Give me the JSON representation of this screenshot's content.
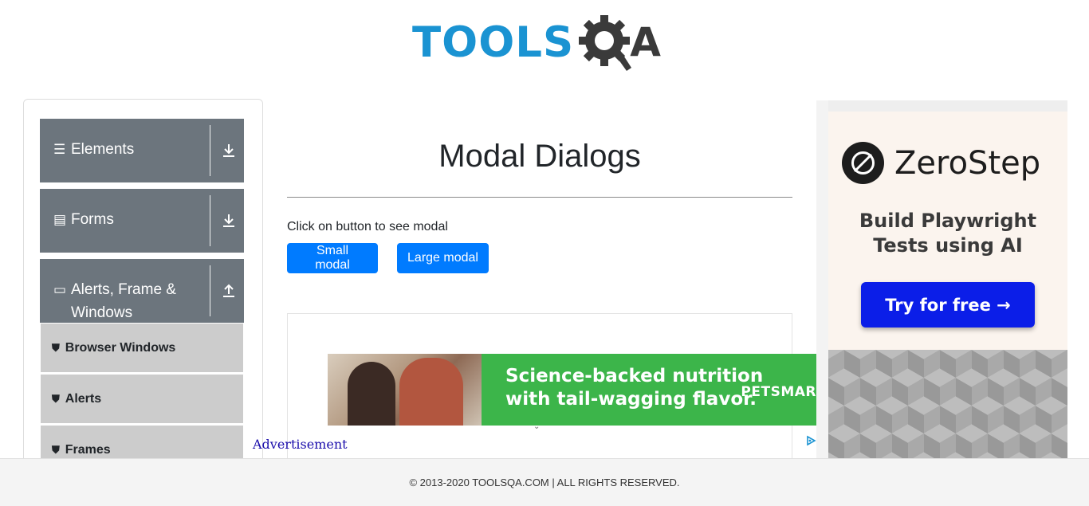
{
  "header": {
    "logo_text_main": "TOOLS",
    "logo_text_suffix": "A"
  },
  "sidebar": {
    "groups": [
      {
        "label": "Elements",
        "icon": "hamburger-icon",
        "arrow": "download-arrow-icon"
      },
      {
        "label": "Forms",
        "icon": "document-icon",
        "arrow": "download-arrow-icon"
      },
      {
        "label": "Alerts, Frame &",
        "label2": "Windows",
        "icon": "window-icon",
        "arrow": "upload-arrow-icon"
      }
    ],
    "sub_items": [
      {
        "label": "Browser Windows",
        "icon": "html5-icon"
      },
      {
        "label": "Alerts",
        "icon": "html5-icon"
      },
      {
        "label": "Frames",
        "icon": "html5-icon"
      }
    ]
  },
  "main": {
    "title": "Modal Dialogs",
    "hint": "Click on button to see modal",
    "small_button": "Small modal",
    "large_button": "Large modal"
  },
  "ad": {
    "banner_line1": "Science-backed nutrition",
    "banner_line2": "with tail-wagging flavor.",
    "banner_brand": "PETSMAR",
    "label": "Advertisement"
  },
  "right_ad": {
    "brand": "ZeroStep",
    "subtitle_line1": "Build Playwright",
    "subtitle_line2": "Tests using AI",
    "cta": "Try for free →"
  },
  "footer": {
    "text": "© 2013-2020 TOOLSQA.COM | ALL RIGHTS RESERVED."
  },
  "colors": {
    "primary_button": "#007bff",
    "sidebar_group": "#6c757d",
    "sidebar_sub": "#cccccc",
    "logo_blue": "#1a93d2"
  }
}
